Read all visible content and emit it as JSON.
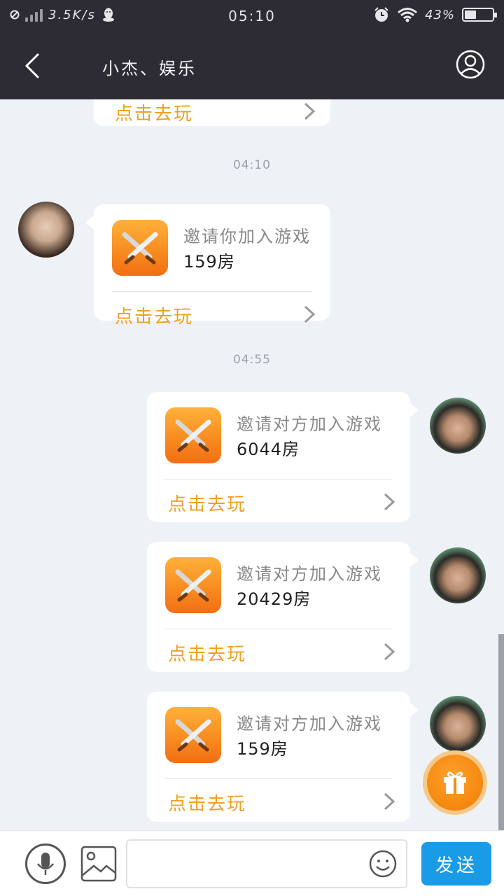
{
  "status_bar": {
    "net_speed": "3.5K/s",
    "time": "05:10",
    "battery": "43%",
    "battery_level": 0.43,
    "icons": [
      "signal-icon",
      "qq-icon",
      "alarm-icon",
      "wifi-icon",
      "battery-icon"
    ]
  },
  "header": {
    "title": "小杰、娱乐",
    "back_icon": "back-arrow-icon",
    "profile_icon": "user-profile-icon"
  },
  "messages": [
    {
      "play_label": "点击去玩"
    },
    {
      "timestamp": "04:10"
    },
    {
      "invite": "邀请你加入游戏",
      "room": "159房",
      "play_label": "点击去玩"
    },
    {
      "timestamp": "04:55"
    },
    {
      "invite": "邀请对方加入游戏",
      "room": "6044房",
      "play_label": "点击去玩"
    },
    {
      "invite": "邀请对方加入游戏",
      "room": "20429房",
      "play_label": "点击去玩"
    },
    {
      "invite": "邀请对方加入游戏",
      "room": "159房",
      "play_label": "点击去玩"
    }
  ],
  "input_bar": {
    "placeholder": "",
    "send_label": "发送"
  },
  "colors": {
    "header_bg": "#2d2c35",
    "chat_bg": "#eef2f6",
    "accent_orange": "#f0a020",
    "send_blue": "#1a9be6"
  }
}
